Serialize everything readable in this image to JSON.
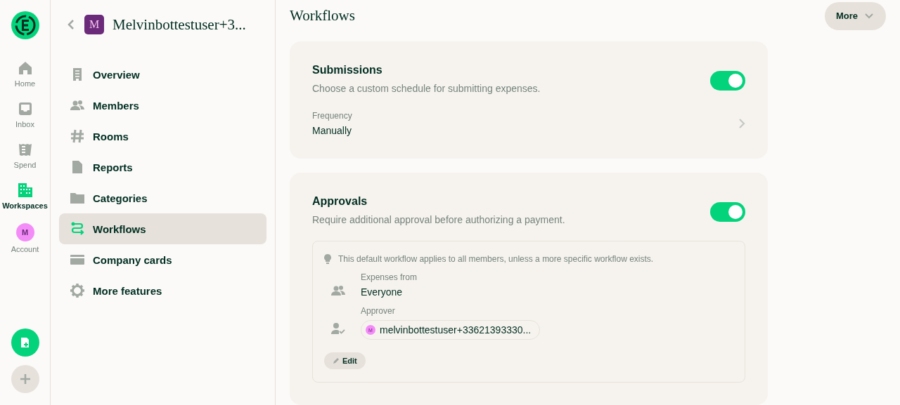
{
  "rail": {
    "items": [
      {
        "kind": "home",
        "label": "Home",
        "selected": false
      },
      {
        "kind": "inbox",
        "label": "Inbox",
        "selected": false
      },
      {
        "kind": "spend",
        "label": "Spend",
        "selected": false
      },
      {
        "kind": "workspaces",
        "label": "Workspaces",
        "selected": true
      },
      {
        "kind": "account",
        "label": "Account",
        "avatar": "M",
        "selected": false
      }
    ]
  },
  "workspace": {
    "avatar": "M",
    "name": "Melvinbottestuser+3..."
  },
  "menu": [
    {
      "kind": "overview",
      "label": "Overview",
      "selected": false
    },
    {
      "kind": "members",
      "label": "Members",
      "selected": false
    },
    {
      "kind": "rooms",
      "label": "Rooms",
      "selected": false
    },
    {
      "kind": "reports",
      "label": "Reports",
      "selected": false
    },
    {
      "kind": "categories",
      "label": "Categories",
      "selected": false
    },
    {
      "kind": "workflows",
      "label": "Workflows",
      "selected": true
    },
    {
      "kind": "cards",
      "label": "Company cards",
      "selected": false
    },
    {
      "kind": "features",
      "label": "More features",
      "selected": false
    }
  ],
  "page": {
    "title": "Workflows",
    "more_button": "More"
  },
  "submissions": {
    "title": "Submissions",
    "description": "Choose a custom schedule for submitting expenses.",
    "on": true,
    "frequency_label": "Frequency",
    "frequency_value": "Manually"
  },
  "approvals": {
    "title": "Approvals",
    "description": "Require additional approval before authorizing a payment.",
    "on": true,
    "hint": "This default workflow applies to all members, unless a more specific workflow exists.",
    "expenses_from_label": "Expenses from",
    "expenses_from_value": "Everyone",
    "approver_label": "Approver",
    "approver_avatar": "M",
    "approver": "melvinbottestuser+33621393330...",
    "edit_button": "Edit"
  }
}
